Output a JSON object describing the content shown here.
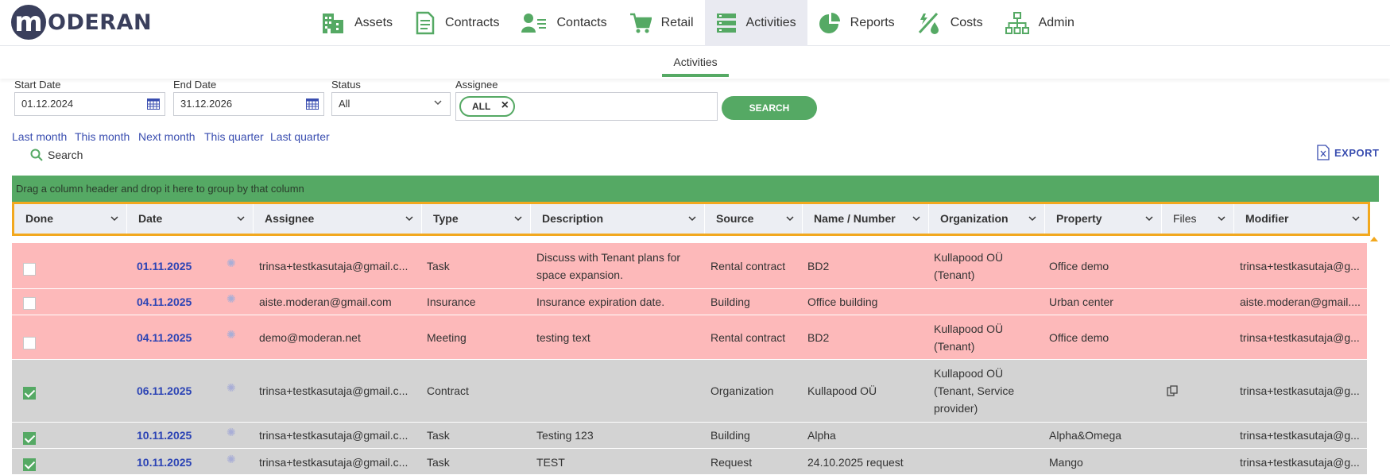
{
  "brand": {
    "logo_letter": "m",
    "logo_text": "ODERAN"
  },
  "nav": [
    {
      "label": "Assets",
      "icon": "buildings-icon"
    },
    {
      "label": "Contracts",
      "icon": "document-icon"
    },
    {
      "label": "Contacts",
      "icon": "contact-card-icon"
    },
    {
      "label": "Retail",
      "icon": "cart-icon"
    },
    {
      "label": "Activities",
      "icon": "list-icon",
      "active": true
    },
    {
      "label": "Reports",
      "icon": "pie-chart-icon"
    },
    {
      "label": "Costs",
      "icon": "costs-icon"
    },
    {
      "label": "Admin",
      "icon": "org-chart-icon"
    }
  ],
  "subtab": "Activities",
  "filters": {
    "start_date_label": "Start Date",
    "start_date": "01.12.2024",
    "end_date_label": "End Date",
    "end_date": "31.12.2026",
    "status_label": "Status",
    "status": "All",
    "assignee_label": "Assignee",
    "assignee_chip": "ALL",
    "search_button": "SEARCH"
  },
  "quick_ranges": [
    "Last month",
    "This month",
    "Next month",
    "This quarter",
    "Last quarter"
  ],
  "search_link": "Search",
  "export_label": "EXPORT",
  "group_panel": "Drag a column header and drop it here to group by that column",
  "columns": [
    "Done",
    "Date",
    "Assignee",
    "Type",
    "Description",
    "Source",
    "Name / Number",
    "Organization",
    "Property",
    "Files",
    "Modifier"
  ],
  "rows": [
    {
      "done": false,
      "date": "01.11.2025",
      "assignee": "trinsa+testkasutaja@gmail.c...",
      "type": "Task",
      "description": [
        "Discuss with Tenant plans for",
        "space expansion."
      ],
      "source": "Rental contract",
      "name": "BD2",
      "organization": [
        "Kullapood OÜ",
        "(Tenant)"
      ],
      "property": "Office demo",
      "files": false,
      "modifier": "trinsa+testkasutaja@g..."
    },
    {
      "done": false,
      "date": "04.11.2025",
      "assignee": "aiste.moderan@gmail.com",
      "type": "Insurance",
      "description": [
        "Insurance expiration date."
      ],
      "source": "Building",
      "name": "Office building",
      "organization": [],
      "property": "Urban center",
      "files": false,
      "modifier": "aiste.moderan@gmail...."
    },
    {
      "done": false,
      "date": "04.11.2025",
      "assignee": "demo@moderan.net",
      "type": "Meeting",
      "description": [
        "testing text"
      ],
      "source": "Rental contract",
      "name": "BD2",
      "organization": [
        "Kullapood OÜ",
        "(Tenant)"
      ],
      "property": "Office demo",
      "files": false,
      "modifier": "trinsa+testkasutaja@g..."
    },
    {
      "done": true,
      "date": "06.11.2025",
      "assignee": "trinsa+testkasutaja@gmail.c...",
      "type": "Contract",
      "description": [],
      "source": "Organization",
      "name": "Kullapood OÜ",
      "organization": [
        "Kullapood OÜ",
        "(Tenant, Service",
        "provider)"
      ],
      "property": "",
      "files": true,
      "modifier": "trinsa+testkasutaja@g..."
    },
    {
      "done": true,
      "date": "10.11.2025",
      "assignee": "trinsa+testkasutaja@gmail.c...",
      "type": "Task",
      "description": [
        "Testing 123"
      ],
      "source": "Building",
      "name": "Alpha",
      "organization": [],
      "property": "Alpha&Omega",
      "files": false,
      "modifier": "trinsa+testkasutaja@g..."
    },
    {
      "done": true,
      "date": "10.11.2025",
      "assignee": "trinsa+testkasutaja@gmail.c...",
      "type": "Task",
      "description": [
        "TEST"
      ],
      "source": "Request",
      "name": "24.10.2025 request",
      "organization": [],
      "property": "Mango",
      "files": false,
      "modifier": "trinsa+testkasutaja@g..."
    }
  ],
  "colors": {
    "accent": "#55a964",
    "link": "#2c44b5",
    "overdue_row": "#fdb9ba",
    "done_row": "#d3d3d3",
    "header_highlight": "#f2a81e"
  }
}
